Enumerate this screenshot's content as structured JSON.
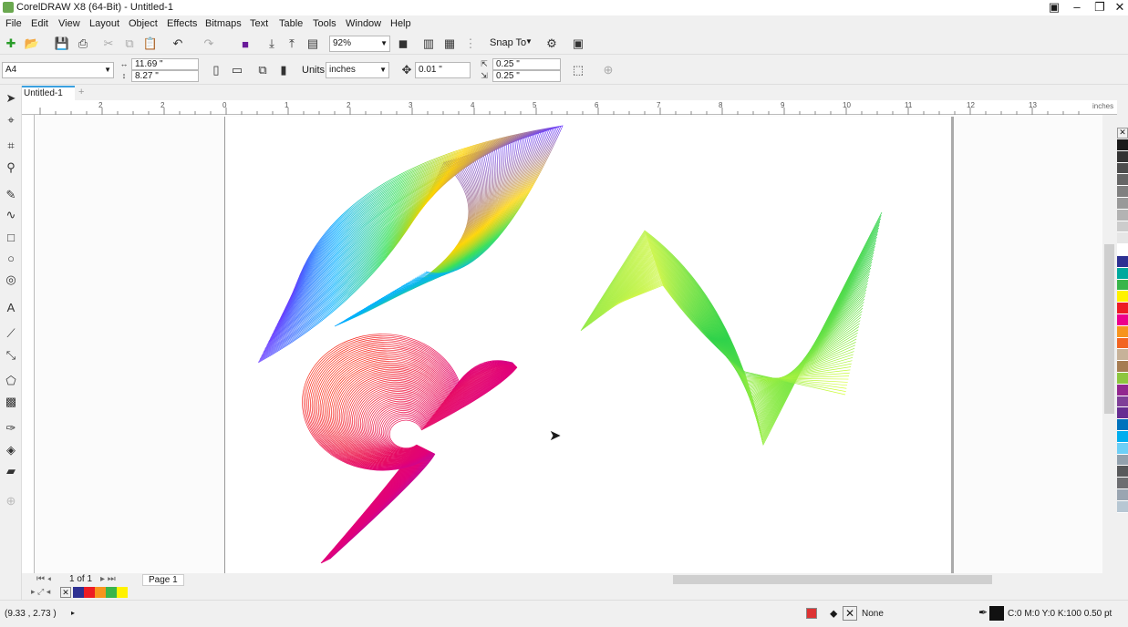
{
  "window": {
    "title": "CorelDRAW X8 (64-Bit) - Untitled-1"
  },
  "menu": [
    "File",
    "Edit",
    "View",
    "Layout",
    "Object",
    "Effects",
    "Bitmaps",
    "Text",
    "Table",
    "Tools",
    "Window",
    "Help"
  ],
  "toolbar": {
    "zoom": "92%",
    "snap_to": "Snap To"
  },
  "property_bar": {
    "paper_size": "A4",
    "width": "11.69 \"",
    "height": "8.27 \"",
    "units_label": "Units:",
    "units_value": "inches",
    "nudge": "0.01 \"",
    "dup_x": "0.25 \"",
    "dup_y": "0.25 \""
  },
  "tabs": {
    "active": "Untitled-1"
  },
  "ruler": {
    "labels": [
      "2",
      "2",
      "0",
      "1",
      "2",
      "3",
      "4",
      "5",
      "6",
      "7",
      "8",
      "9",
      "10",
      "11",
      "12",
      "13"
    ],
    "unit": "inches"
  },
  "navigator": {
    "page_count": "1 of 1",
    "page_tab": "Page 1"
  },
  "status": {
    "coords": "(9.33 , 2.73 )",
    "fill": "None",
    "outline": "C:0 M:0 Y:0 K:100  0.50 pt"
  },
  "palette_colors": [
    "#1a1a1a",
    "#333333",
    "#4d4d4d",
    "#666666",
    "#808080",
    "#999999",
    "#b3b3b3",
    "#cccccc",
    "#e6e6e6",
    "#ffffff",
    "#2e3192",
    "#00a99d",
    "#39b54a",
    "#fff200",
    "#ed1c24",
    "#ec008c",
    "#f7941d",
    "#f26522",
    "#c7b299",
    "#a67c52",
    "#8dc63f",
    "#92278f",
    "#7f3f98",
    "#662d91",
    "#0072bc",
    "#00aeef",
    "#6dcff6",
    "#93a1ad",
    "#58595b",
    "#6d6e71",
    "#9aa5b1",
    "#b7c7d3"
  ],
  "doc_palette": [
    "#2e3192",
    "#ed1c24",
    "#f7941d",
    "#39b54a",
    "#fff200"
  ]
}
